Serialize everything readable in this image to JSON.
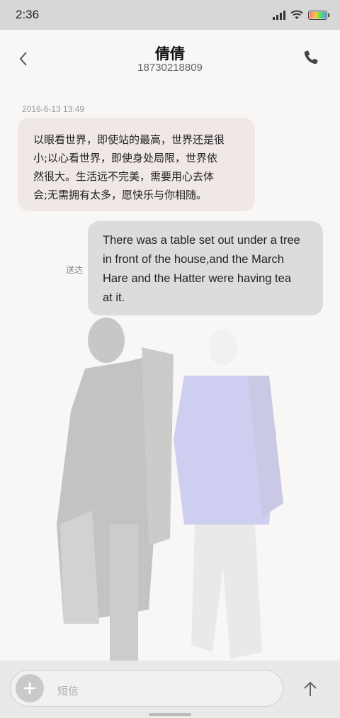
{
  "status_bar": {
    "time": "2:36",
    "icons": [
      "signal-icon",
      "wifi-icon",
      "battery-icon"
    ]
  },
  "header": {
    "contact_name": "倩倩",
    "contact_number": "18730218809",
    "back_icon": "chevron-left-icon",
    "call_icon": "phone-icon"
  },
  "messages": [
    {
      "direction": "incoming",
      "timestamp": "2016-6-13 13:49",
      "lines": [
        "以眼看世界，即使站的最高，世界还是很",
        "小;以心看世界，即使身处局限，世界依",
        "然很大。生活远不完美，需要用心去体",
        "会;无需拥有太多，愿快乐与你相随。"
      ]
    },
    {
      "direction": "outgoing",
      "status": "送达",
      "lines": [
        "There was a table set out under a tree",
        "in front of the house,and the March",
        "Hare and the Hatter were having tea",
        "at it."
      ]
    }
  ],
  "composer": {
    "placeholder": "短信",
    "attach_icon": "plus-icon",
    "send_icon": "arrow-up-icon"
  },
  "colors": {
    "incoming_bubble": "#efe8e6",
    "outgoing_bubble": "#dcdcdc",
    "status_bar": "#d7d7d7"
  }
}
